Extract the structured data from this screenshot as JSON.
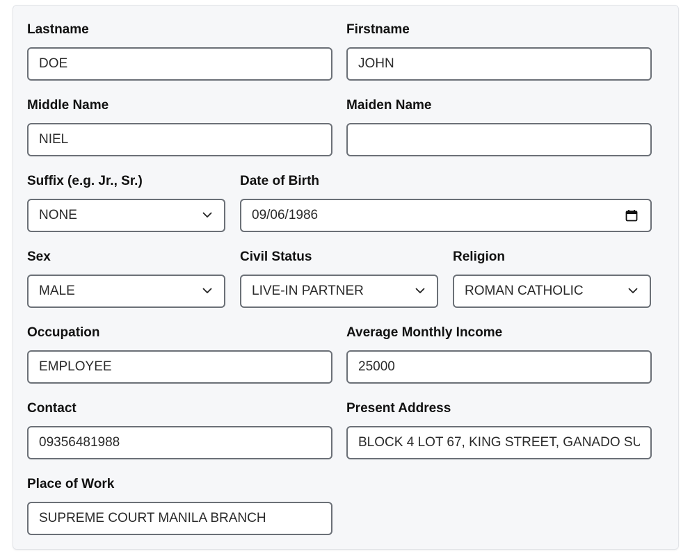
{
  "form": {
    "lastname": {
      "label": "Lastname",
      "value": "DOE"
    },
    "firstname": {
      "label": "Firstname",
      "value": "JOHN"
    },
    "middle_name": {
      "label": "Middle Name",
      "value": "NIEL"
    },
    "maiden_name": {
      "label": "Maiden Name",
      "value": ""
    },
    "suffix": {
      "label": "Suffix (e.g. Jr., Sr.)",
      "value": "NONE"
    },
    "date_of_birth": {
      "label": "Date of Birth",
      "value": "09/06/1986"
    },
    "sex": {
      "label": "Sex",
      "value": "MALE"
    },
    "civil_status": {
      "label": "Civil Status",
      "value": "LIVE-IN PARTNER"
    },
    "religion": {
      "label": "Religion",
      "value": "ROMAN CATHOLIC"
    },
    "occupation": {
      "label": "Occupation",
      "value": "EMPLOYEE"
    },
    "average_monthly_income": {
      "label": "Average Monthly Income",
      "value": "25000"
    },
    "contact": {
      "label": "Contact",
      "value": "09356481988"
    },
    "present_address": {
      "label": "Present Address",
      "value": "BLOCK 4 LOT 67, KING STREET, GANADO SU"
    },
    "place_of_work": {
      "label": "Place of Work",
      "value": "SUPREME COURT MANILA BRANCH"
    }
  },
  "icons": {
    "select": "chevron-down-icon",
    "date": "calendar-icon"
  }
}
